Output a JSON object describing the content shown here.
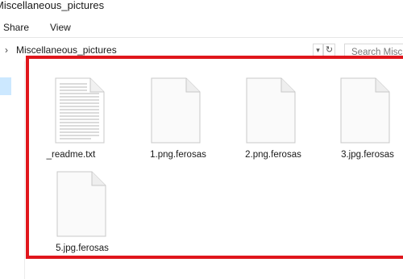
{
  "window": {
    "title": "Miscellaneous_pictures"
  },
  "ribbon": {
    "tabs": [
      "Share",
      "View"
    ]
  },
  "address": {
    "path": "Miscellaneous_pictures"
  },
  "search": {
    "placeholder": "Search Misc"
  },
  "highlight_color": "#e0161c",
  "files": [
    {
      "name": "_readme.txt",
      "icon": "text-file-icon"
    },
    {
      "name": "1.png.ferosas",
      "icon": "blank-file-icon"
    },
    {
      "name": "2.png.ferosas",
      "icon": "blank-file-icon"
    },
    {
      "name": "3.jpg.ferosas",
      "icon": "blank-file-icon"
    },
    {
      "name": "5.jpg.ferosas",
      "icon": "blank-file-icon"
    }
  ]
}
